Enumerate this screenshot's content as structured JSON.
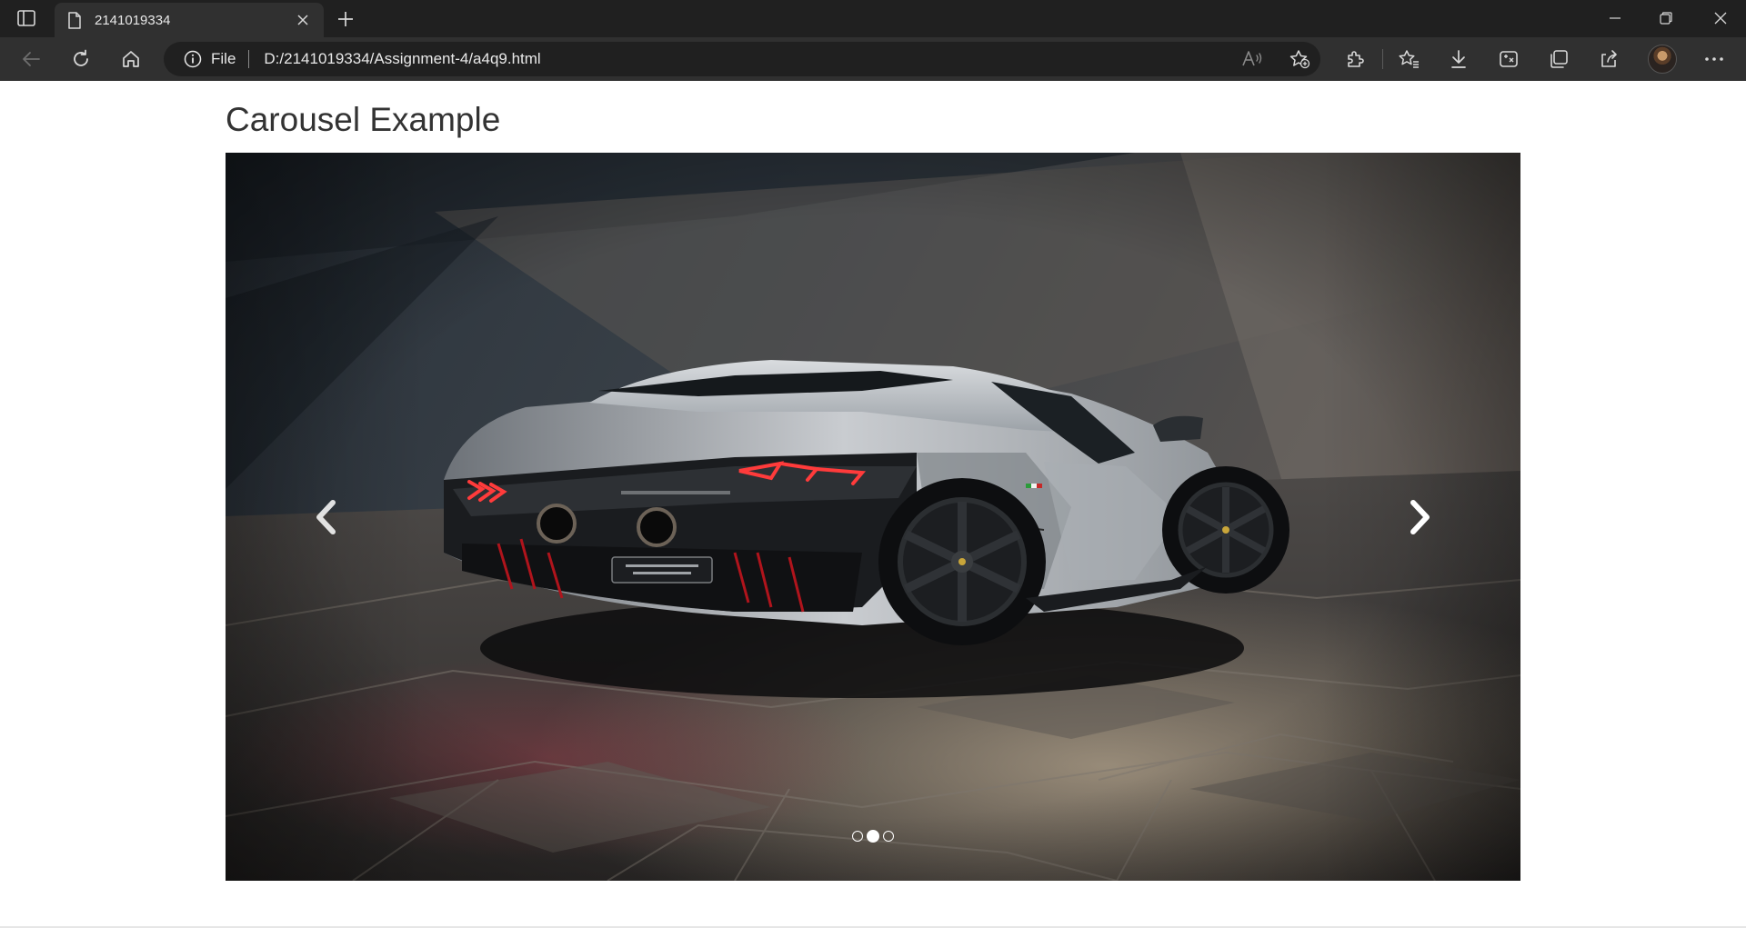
{
  "browser": {
    "tab": {
      "title": "2141019334"
    },
    "address_bar": {
      "site_info_label": "File",
      "url": "D:/2141019334/Assignment-4/a4q9.html"
    },
    "colors": {
      "frame": "#202020",
      "toolbar": "#303030",
      "icon": "#d8d8d8"
    }
  },
  "page": {
    "title": "Carousel Example",
    "carousel": {
      "slide_count": 3,
      "active_slide_index": 1,
      "current_slide": "Lamborghini Aventador Ultimae rear view",
      "prev_icon": "chevron-left-icon",
      "next_icon": "chevron-right-icon"
    }
  }
}
